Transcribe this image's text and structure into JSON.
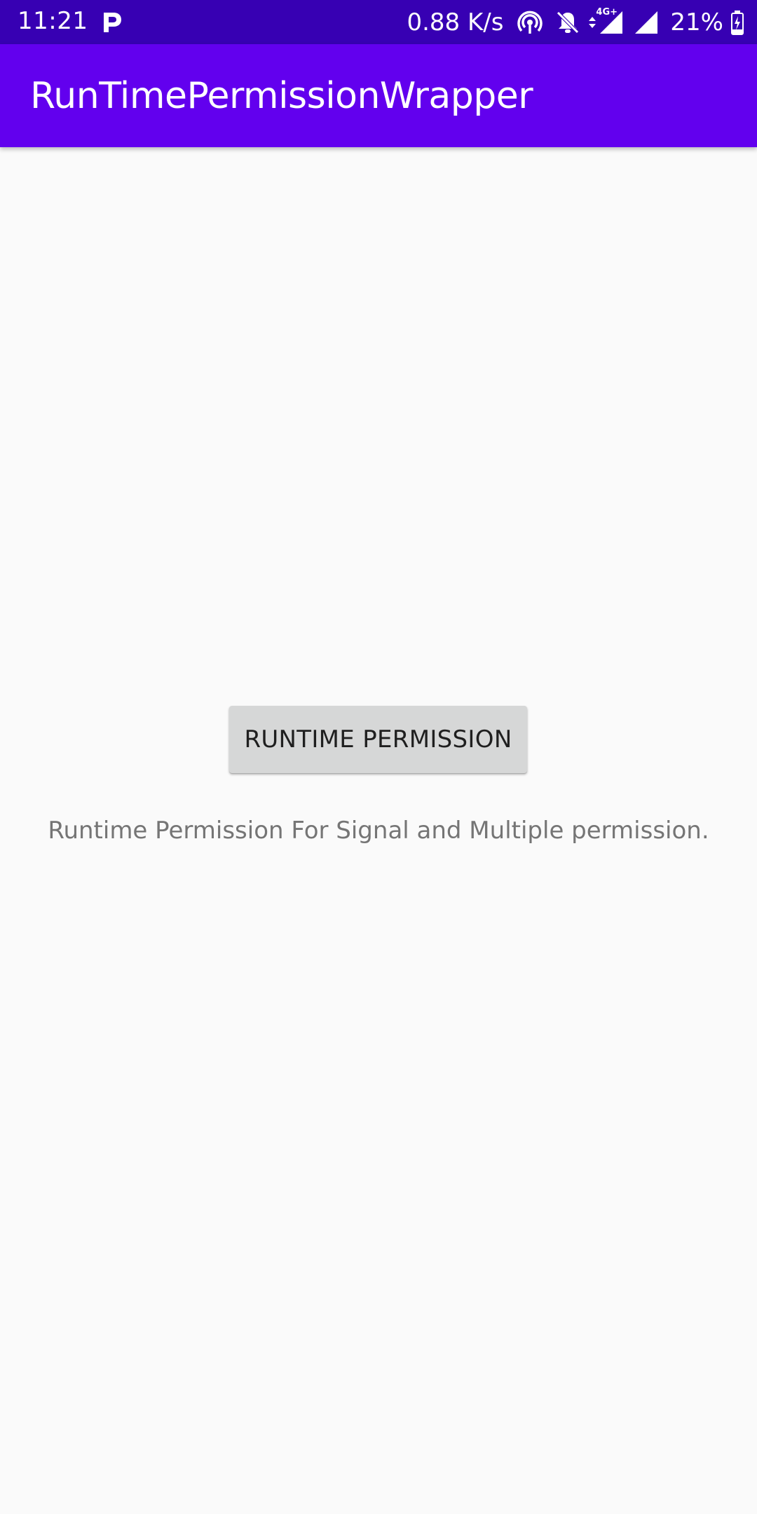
{
  "status_bar": {
    "time": "11:21",
    "network_speed": "0.88 K/s",
    "network_type": "4G+",
    "battery_percent": "21%",
    "icons": [
      "parking-app-icon",
      "hotspot-icon",
      "notifications-muted-icon",
      "data-arrows-icon",
      "signal-4g-icon",
      "signal-icon",
      "battery-charging-icon"
    ],
    "background_color": "#3700b3"
  },
  "app_bar": {
    "title": "RunTimePermissionWrapper",
    "background_color": "#6200ee"
  },
  "main": {
    "button_label": "RUNTIME PERMISSION",
    "description": "Runtime Permission For Signal and Multiple permission."
  }
}
